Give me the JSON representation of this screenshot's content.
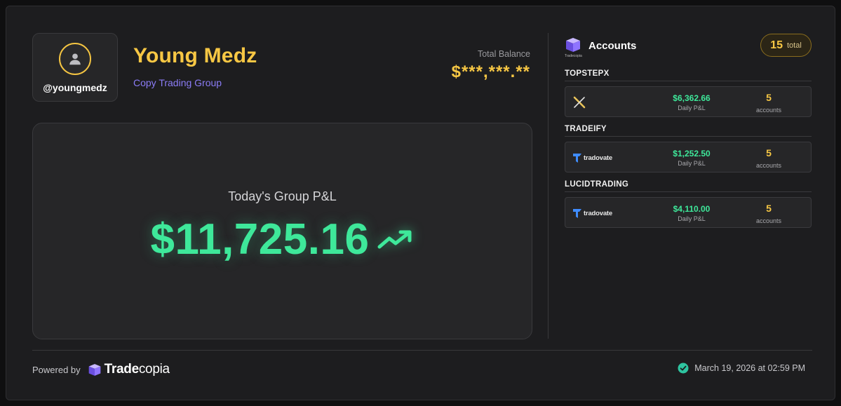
{
  "profile": {
    "handle": "@youngmedz",
    "name": "Young Medz",
    "group": "Copy Trading Group"
  },
  "balance": {
    "label": "Total Balance",
    "value": "$***,***.**"
  },
  "pnl": {
    "label": "Today's Group P&L",
    "value": "$11,725.16"
  },
  "accounts": {
    "logo_sub": "Tradecopia",
    "title": "Accounts",
    "total_count": "15",
    "total_label": "total",
    "firms": [
      {
        "name": "TOPSTEPX",
        "platform": "",
        "platform_icon": "topstepx-x-icon",
        "amount": "$6,362.66",
        "amount_label": "Daily P&L",
        "count": "5",
        "count_label": "accounts"
      },
      {
        "name": "TRADEIFY",
        "platform": "tradovate",
        "platform_icon": "tradovate-icon",
        "amount": "$1,252.50",
        "amount_label": "Daily P&L",
        "count": "5",
        "count_label": "accounts"
      },
      {
        "name": "LUCIDTRADING",
        "platform": "tradovate",
        "platform_icon": "tradovate-icon",
        "amount": "$4,110.00",
        "amount_label": "Daily P&L",
        "count": "5",
        "count_label": "accounts"
      }
    ]
  },
  "footer": {
    "powered_by": "Powered by",
    "brand_bold": "Trade",
    "brand_light": "copia",
    "timestamp": "March 19, 2026 at 02:59 PM"
  },
  "colors": {
    "accent_gold": "#f7c744",
    "profit_green": "#3ee89a",
    "group_purple": "#8b7cf6",
    "background": "#1d1d1f"
  }
}
